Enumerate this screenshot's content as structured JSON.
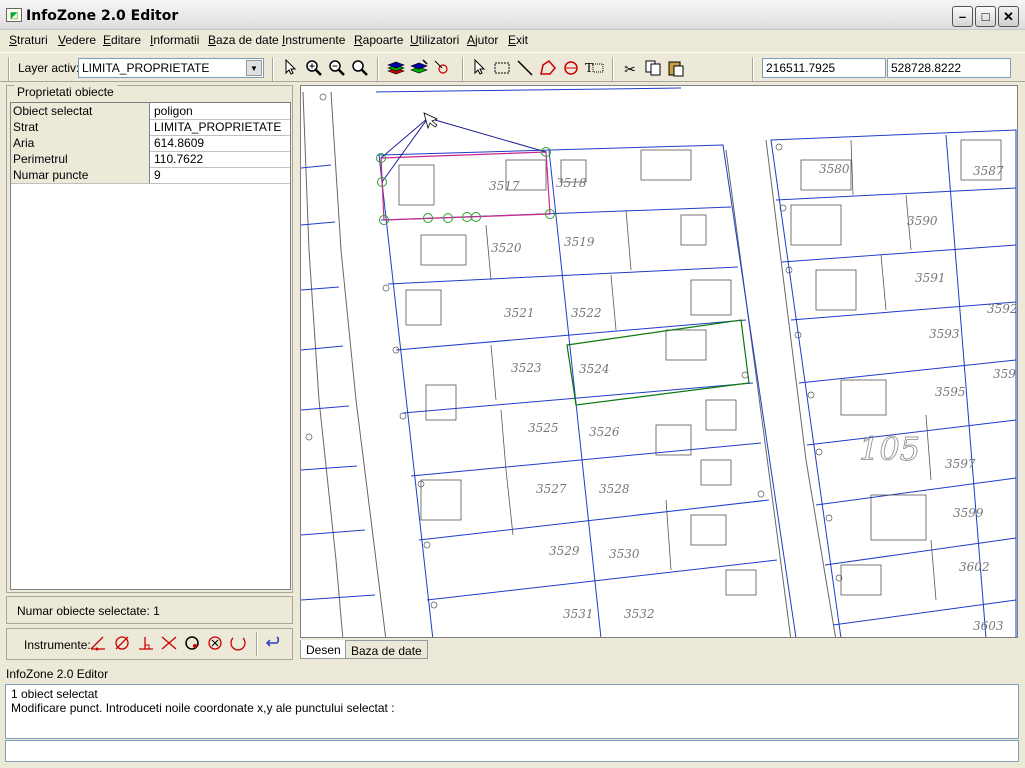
{
  "window": {
    "title": "InfoZone 2.0 Editor",
    "minimize": "–",
    "maximize": "□",
    "close": "✕"
  },
  "menu": [
    "Straturi",
    "Vedere",
    "Editare",
    "Informatii",
    "Baza de date",
    "Instrumente",
    "Rapoarte",
    "Utilizatori",
    "Ajutor",
    "Exit"
  ],
  "toolbar": {
    "layer_label": "Layer activ:",
    "layer_value": "LIMITA_PROPRIETATE",
    "coord_x": "216511.7925",
    "coord_y": "528728.8222"
  },
  "properties": {
    "legend": "Proprietati obiecte",
    "rows": [
      {
        "key": "Obiect selectat",
        "value": "poligon"
      },
      {
        "key": "Strat",
        "value": "LIMITA_PROPRIETATE"
      },
      {
        "key": "Aria",
        "value": "614.8609"
      },
      {
        "key": "Perimetrul",
        "value": "110.7622"
      },
      {
        "key": "Numar puncte",
        "value": "9"
      }
    ]
  },
  "selection_count": "Numar obiecte selectate: 1",
  "instruments_label": "Instrumente:",
  "tabs": {
    "desen": "Desen",
    "baza": "Baza de date"
  },
  "status_caption": "InfoZone 2.0 Editor",
  "log": [
    "1 obiect selectat",
    "Modificare punct. Introduceti noile coordonate x,y ale punctului selectat :"
  ],
  "map": {
    "parcels": [
      "3517",
      "3518",
      "3520",
      "3519",
      "3521",
      "3522",
      "3523",
      "3524",
      "3525",
      "3526",
      "3527",
      "3528",
      "3529",
      "3530",
      "3531",
      "3532",
      "3580",
      "3587",
      "3590",
      "3591",
      "3592",
      "3593",
      "3595",
      "3597",
      "3599",
      "3602",
      "3603",
      "359"
    ],
    "block_label": "105"
  },
  "colors": {
    "parcel_line": "#1e3cc8",
    "selected": "#c8288c",
    "highlight": "#0a7a0a",
    "vertex": "#2aa02a",
    "building": "#555555"
  }
}
